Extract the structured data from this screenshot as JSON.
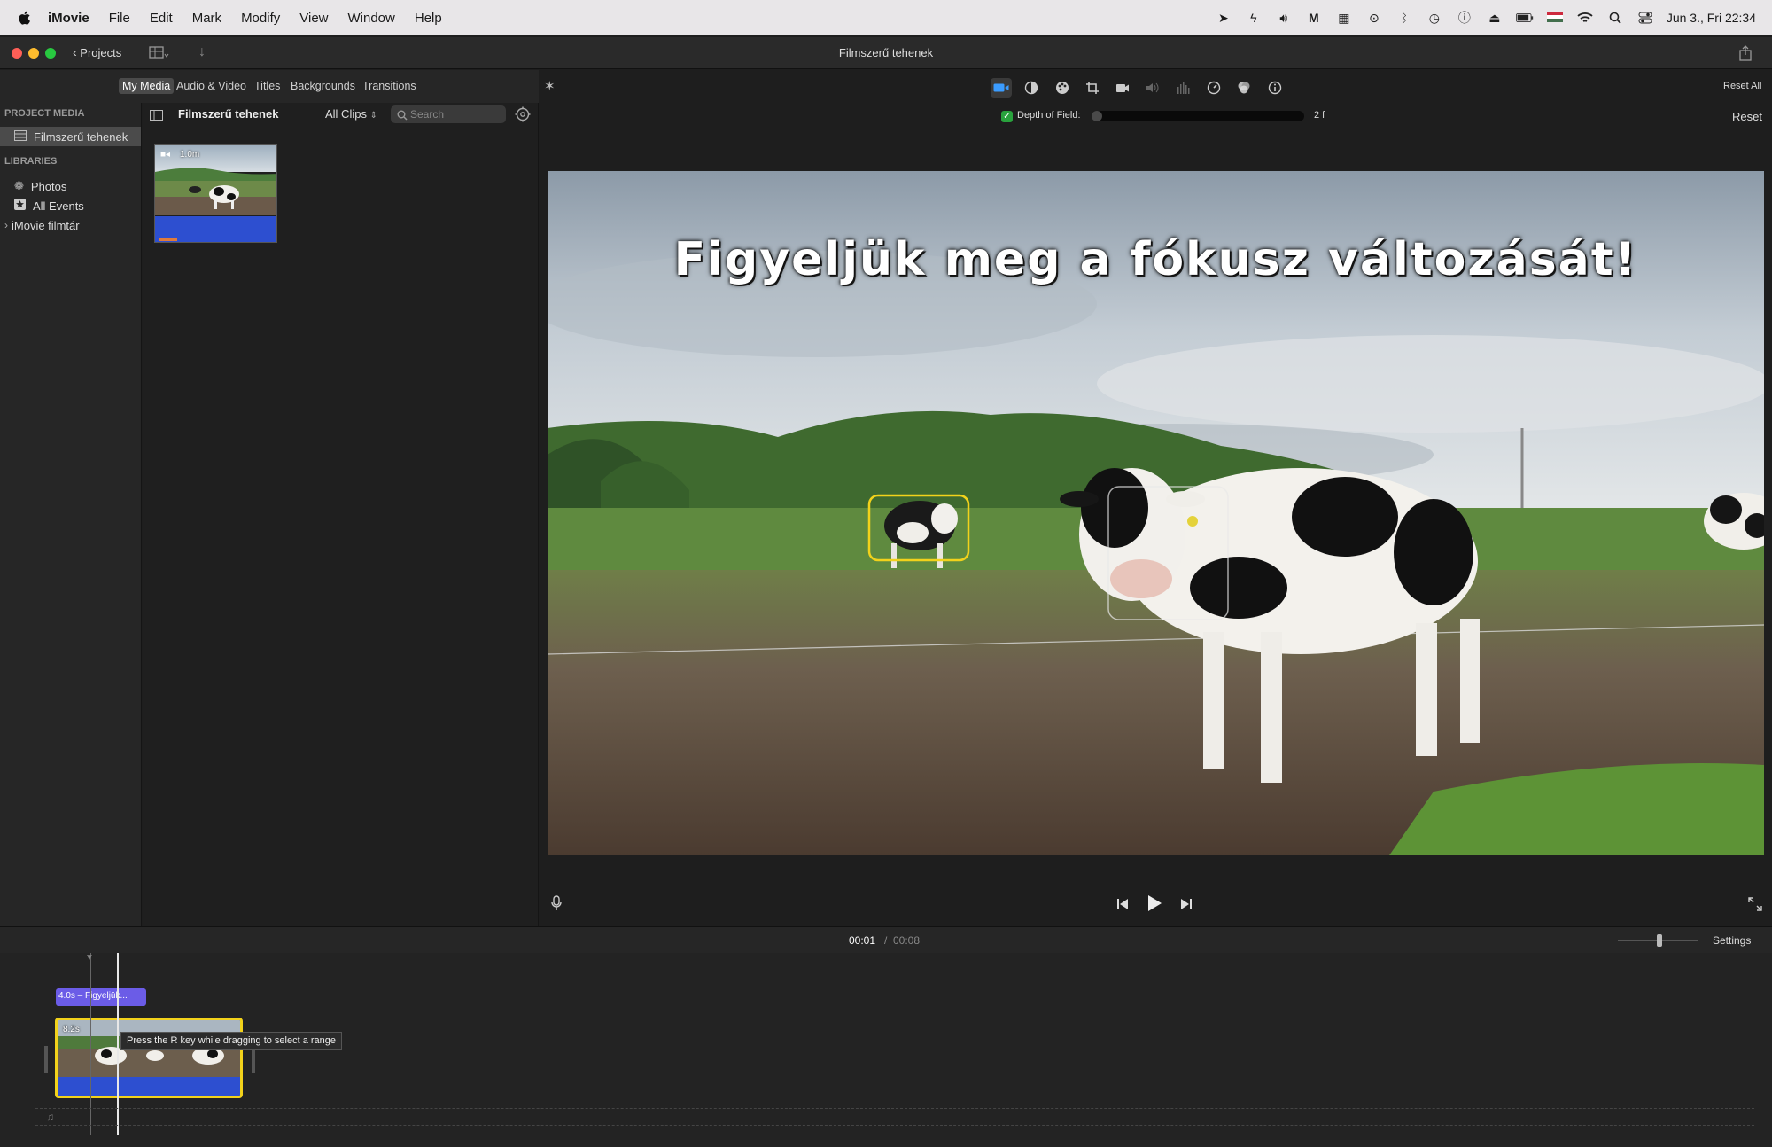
{
  "menubar": {
    "app_name": "iMovie",
    "items": [
      "File",
      "Edit",
      "Mark",
      "Modify",
      "View",
      "Window",
      "Help"
    ],
    "datetime": "Jun 3., Fri 22:34"
  },
  "window": {
    "title": "Filmszerű tehenek",
    "projects_label": "Projects"
  },
  "browser_tabs": [
    "My Media",
    "Audio & Video",
    "Titles",
    "Backgrounds",
    "Transitions"
  ],
  "sidebar": {
    "project_media_header": "PROJECT MEDIA",
    "project_item": "Filmszerű tehenek",
    "libraries_header": "LIBRARIES",
    "photos": "Photos",
    "all_events": "All Events",
    "library": "iMovie filmtár"
  },
  "browser": {
    "title": "Filmszerű tehenek",
    "filter": "All Clips",
    "search_placeholder": "Search",
    "clip_duration": "1.0m"
  },
  "adjustments": {
    "reset_all": "Reset All",
    "reset": "Reset",
    "dof_label": "Depth of Field:",
    "dof_value": "2 f",
    "dof_level": 0.0
  },
  "viewer": {
    "overlay_title": "Figyeljük meg a fókusz változását!"
  },
  "playback": {
    "current": "00:01",
    "separator": "/",
    "total": "00:08",
    "settings": "Settings"
  },
  "timeline": {
    "title_clip": "4.0s – Figyeljük...",
    "video_clip_duration": "8.2s",
    "tooltip": "Press the R key while dragging to select a range"
  },
  "colors": {
    "accent": "#3b9cff",
    "title_clip": "#6b5ce7",
    "selection_yellow": "#f2d21b",
    "audio_blue": "#2d4fd0"
  }
}
